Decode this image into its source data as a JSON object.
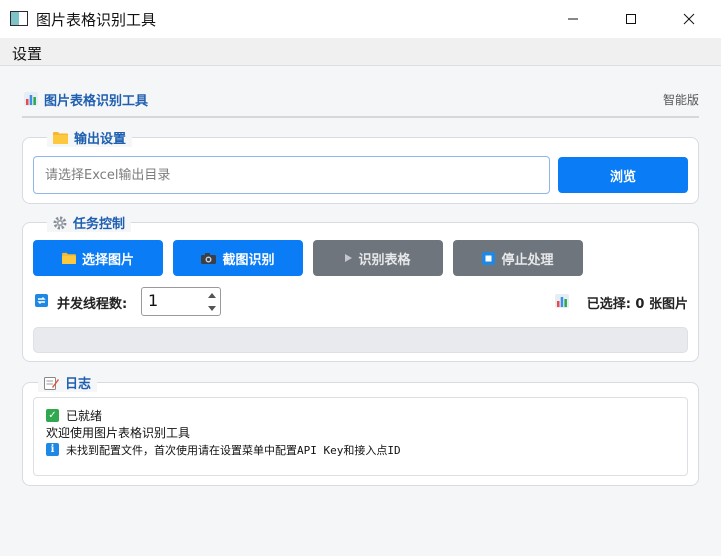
{
  "window": {
    "title": "图片表格识别工具"
  },
  "menu": {
    "items": [
      "设置"
    ]
  },
  "header": {
    "title": "图片表格识别工具",
    "badge": "智能版"
  },
  "output_settings": {
    "legend": "输出设置",
    "path_placeholder": "请选择Excel输出目录",
    "path_value": "",
    "browse_label": "浏览"
  },
  "task_control": {
    "legend": "任务控制",
    "buttons": [
      {
        "label": "选择图片",
        "icon": "folder-icon",
        "enabled": true
      },
      {
        "label": "截图识别",
        "icon": "camera-icon",
        "enabled": true
      },
      {
        "label": "识别表格",
        "icon": "play-icon",
        "enabled": false
      },
      {
        "label": "停止处理",
        "icon": "stop-icon",
        "enabled": false
      }
    ],
    "threads_label": "并发线程数:",
    "threads_value": "1",
    "selected_text": "已选择: 0 张图片",
    "progress": 0
  },
  "log": {
    "legend": "日志",
    "lines": [
      {
        "icon": "check-icon",
        "text": "已就绪"
      },
      {
        "icon": "",
        "text": "欢迎使用图片表格识别工具"
      },
      {
        "icon": "info-icon",
        "text": "未找到配置文件，首次使用请在设置菜单中配置API Key和接入点ID"
      }
    ]
  },
  "colors": {
    "accent": "#0a7cf6",
    "disabled": "#6f757d",
    "title_blue": "#1f5fb0"
  }
}
